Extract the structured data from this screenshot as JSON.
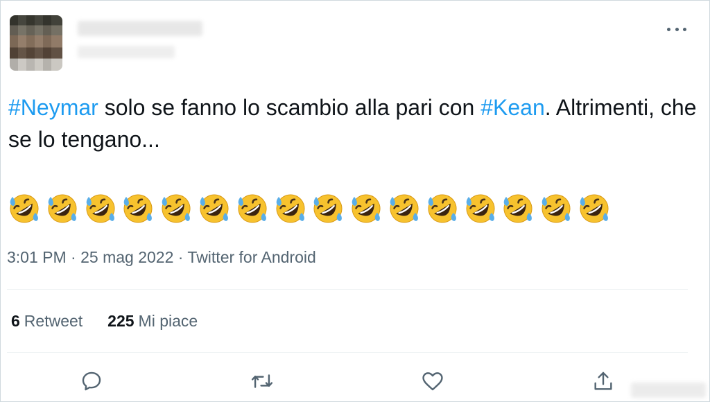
{
  "tweet": {
    "text_parts": [
      {
        "type": "hashtag",
        "text": "#Neymar"
      },
      {
        "type": "text",
        "text": " solo se fanno lo scambio alla pari con "
      },
      {
        "type": "hashtag",
        "text": "#Kean"
      },
      {
        "type": "text",
        "text": ". Altrimenti, che se lo tengano..."
      }
    ],
    "emoji_name": "rolling-on-the-floor-laughing",
    "emoji_count": 16,
    "time": "3:01 PM",
    "date": "25 mag 2022",
    "separator": " · ",
    "source": "Twitter for Android"
  },
  "stats": {
    "retweets_count": "6",
    "retweets_label": "Retweet",
    "likes_count": "225",
    "likes_label": "Mi piace"
  },
  "icons": {
    "more": "more-horizontal-icon",
    "reply": "reply-icon",
    "retweet": "retweet-icon",
    "like": "heart-icon",
    "share": "share-icon"
  },
  "colors": {
    "hashtag": "#1d9bf0",
    "secondary_text": "#536471",
    "primary_text": "#0f1419",
    "divider": "#eff3f4"
  }
}
